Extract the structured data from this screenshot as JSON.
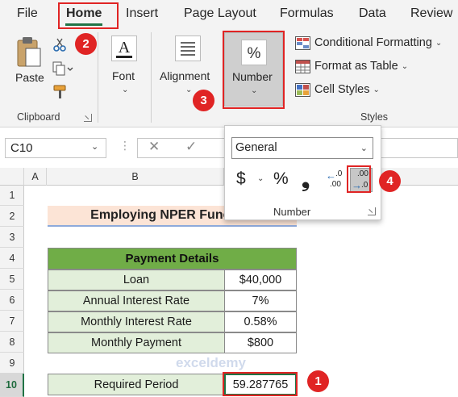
{
  "menu": {
    "file": "File",
    "home": "Home",
    "insert": "Insert",
    "page_layout": "Page Layout",
    "formulas": "Formulas",
    "data": "Data",
    "review": "Review"
  },
  "ribbon": {
    "paste": "Paste",
    "clipboard": "Clipboard",
    "font": "Font",
    "alignment": "Alignment",
    "number": "Number",
    "conditional_formatting": "Conditional Formatting",
    "format_as_table": "Format as Table",
    "cell_styles": "Cell Styles",
    "styles": "Styles"
  },
  "formula_bar": {
    "name_box": "C10",
    "formula": ""
  },
  "dropdown": {
    "format_value": "General",
    "currency": "$",
    "percent": "%",
    "comma": "❟",
    "increase_decimal_top": ".0",
    "increase_decimal_bottom": ".00",
    "decrease_decimal_top": ".00",
    "decrease_decimal_bottom": ".0",
    "label": "Number"
  },
  "columns": [
    "A",
    "B"
  ],
  "rows": [
    "1",
    "2",
    "3",
    "4",
    "5",
    "6",
    "7",
    "8",
    "9",
    "10"
  ],
  "sheet": {
    "title": "Employing NPER Function",
    "table_header": "Payment Details",
    "items": [
      {
        "label": "Loan",
        "value": "$40,000"
      },
      {
        "label": "Annual Interest Rate",
        "value": "7%"
      },
      {
        "label": "Monthly Interest Rate",
        "value": "0.58%"
      },
      {
        "label": "Monthly Payment",
        "value": "$800"
      }
    ],
    "result_label": "Required Period",
    "result_value": "59.287765"
  },
  "badges": [
    "1",
    "2",
    "3",
    "4"
  ],
  "watermark": "exceldemy",
  "colors": {
    "accent": "#217346",
    "annotation": "#e02424",
    "table_header": "#70ad47",
    "table_fill": "#e2efda",
    "title_fill": "#fce4d6"
  }
}
